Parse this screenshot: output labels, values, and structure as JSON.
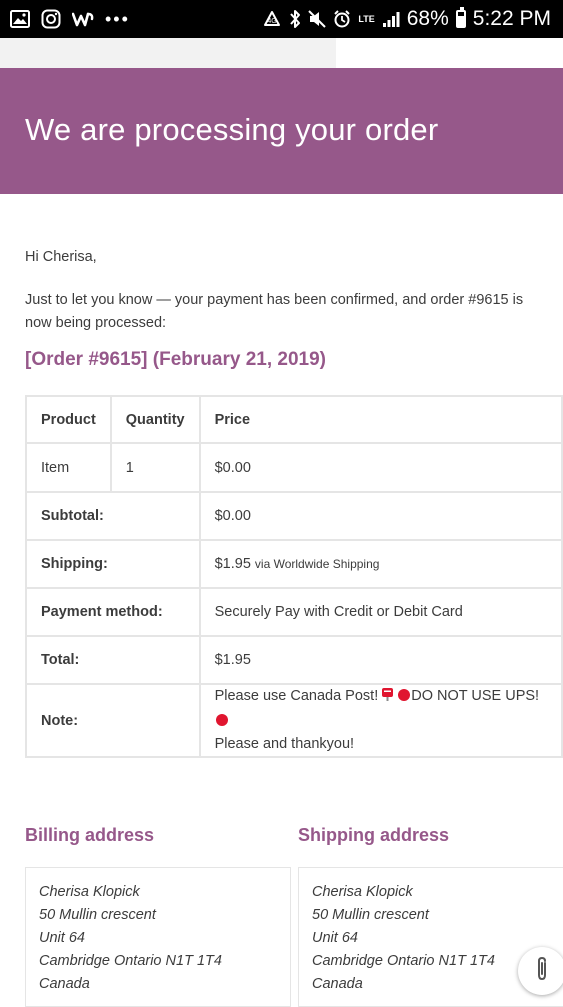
{
  "status_bar": {
    "battery": "68%",
    "battery_level": 0.68,
    "time": "5:22 PM",
    "network": "LTE",
    "left_icons": [
      "gallery-icon",
      "instagram-icon",
      "wish-icon",
      "more-dots-icon"
    ],
    "right_icons": [
      "recycle-icon",
      "bluetooth-icon",
      "mute-icon",
      "alarm-icon",
      "lte-icon",
      "signal-icon",
      "battery-icon"
    ]
  },
  "header": {
    "title": "We are processing your order",
    "background": "#96588a"
  },
  "email": {
    "greeting": "Hi Cherisa,",
    "intro": "Just to let you know — your payment has been confirmed, and order #9615 is now being processed:",
    "order_title": "[Order #9615] (February 21, 2019)",
    "accent": "#96588a"
  },
  "order_table": {
    "headers": [
      "Product",
      "Quantity",
      "Price"
    ],
    "items": [
      {
        "product": "Item",
        "quantity": "1",
        "price": "$0.00"
      }
    ],
    "totals": {
      "subtotal_label": "Subtotal:",
      "subtotal_value": "$0.00",
      "shipping_label": "Shipping:",
      "shipping_value": "$1.95",
      "shipping_via": "via Worldwide Shipping",
      "payment_label": "Payment method:",
      "payment_value": "Securely Pay with Credit or Debit Card",
      "total_label": "Total:",
      "total_value": "$1.95",
      "note_label": "Note:",
      "note_part1": "Please use Canada Post!",
      "note_part2": "DO NOT USE UPS!",
      "note_part3": "Please and thankyou!"
    }
  },
  "billing": {
    "title": "Billing address",
    "lines": [
      "Cherisa Klopick",
      "50 Mullin crescent",
      "Unit 64",
      "Cambridge Ontario N1T 1T4",
      "Canada"
    ]
  },
  "shipping": {
    "title": "Shipping address",
    "lines": [
      "Cherisa Klopick",
      "50 Mullin crescent",
      "Unit 64",
      "Cambridge Ontario N1T 1T4",
      "Canada"
    ]
  }
}
